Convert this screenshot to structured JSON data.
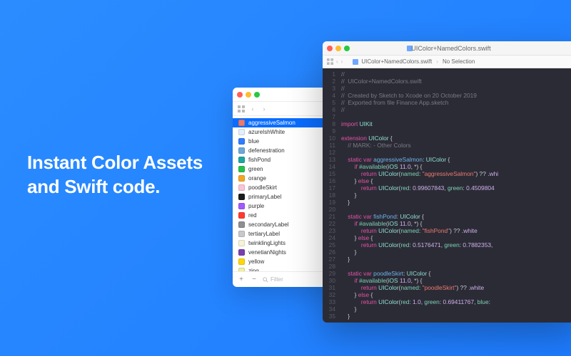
{
  "headline": "Instant Color Assets and Swift code.",
  "assetsWindow": {
    "filterPlaceholder": "Filter",
    "colors": [
      {
        "name": "aggressiveSalmon",
        "hex": "#e97a6f",
        "selected": true
      },
      {
        "name": "azureIshWhite",
        "hex": "#e2f0fb",
        "selected": false
      },
      {
        "name": "blue",
        "hex": "#2f7dff",
        "selected": false
      },
      {
        "name": "defenestration",
        "hex": "#6ea7d9",
        "selected": false
      },
      {
        "name": "fishPond",
        "hex": "#1ca7a0",
        "selected": false
      },
      {
        "name": "green",
        "hex": "#29c14e",
        "selected": false
      },
      {
        "name": "orange",
        "hex": "#f5a623",
        "selected": false
      },
      {
        "name": "poodleSkirt",
        "hex": "#f8c6d6",
        "selected": false
      },
      {
        "name": "primaryLabel",
        "hex": "#1c1c1e",
        "selected": false
      },
      {
        "name": "purple",
        "hex": "#a259ff",
        "selected": false
      },
      {
        "name": "red",
        "hex": "#ff3b30",
        "selected": false
      },
      {
        "name": "secondaryLabel",
        "hex": "#8e8e93",
        "selected": false
      },
      {
        "name": "tertiaryLabel",
        "hex": "#c7c7cc",
        "selected": false
      },
      {
        "name": "twinklingLights",
        "hex": "#f7f3d9",
        "selected": false
      },
      {
        "name": "venetianNights",
        "hex": "#7a3eb1",
        "selected": false
      },
      {
        "name": "yellow",
        "hex": "#ffd60a",
        "selected": false
      },
      {
        "name": "zing",
        "hex": "#f0f0a0",
        "selected": false
      }
    ]
  },
  "codeWindow": {
    "title": "UIColor+NamedColors.swift",
    "breadcrumb": {
      "file": "UIColor+NamedColors.swift",
      "selection": "No Selection"
    },
    "lines": [
      [
        {
          "t": "//",
          "c": "c-comment"
        }
      ],
      [
        {
          "t": "//  UIColor+NamedColors.swift",
          "c": "c-comment"
        }
      ],
      [
        {
          "t": "//",
          "c": "c-comment"
        }
      ],
      [
        {
          "t": "//  Created by Sketch to Xcode on 20 October 2019",
          "c": "c-comment"
        }
      ],
      [
        {
          "t": "//  Exported from file Finance App.sketch",
          "c": "c-comment"
        }
      ],
      [
        {
          "t": "//",
          "c": "c-comment"
        }
      ],
      [
        {
          "t": " ",
          "c": "c-default"
        }
      ],
      [
        {
          "t": "import ",
          "c": "c-keyword"
        },
        {
          "t": "UIKit",
          "c": "c-type"
        }
      ],
      [
        {
          "t": " ",
          "c": "c-default"
        }
      ],
      [
        {
          "t": "extension ",
          "c": "c-keyword"
        },
        {
          "t": "UIColor ",
          "c": "c-type"
        },
        {
          "t": "{",
          "c": "c-default"
        }
      ],
      [
        {
          "t": "    // MARK: - Other Colors",
          "c": "c-comment"
        }
      ],
      [
        {
          "t": " ",
          "c": "c-default"
        }
      ],
      [
        {
          "t": "    static var ",
          "c": "c-keyword"
        },
        {
          "t": "aggressiveSalmon",
          "c": "c-varname"
        },
        {
          "t": ": ",
          "c": "c-default"
        },
        {
          "t": "UIColor ",
          "c": "c-type"
        },
        {
          "t": "{",
          "c": "c-default"
        }
      ],
      [
        {
          "t": "        if ",
          "c": "c-keyword"
        },
        {
          "t": "#available",
          "c": "c-func"
        },
        {
          "t": "(",
          "c": "c-default"
        },
        {
          "t": "iOS ",
          "c": "c-type"
        },
        {
          "t": "11.0",
          "c": "c-number"
        },
        {
          "t": ", *) {",
          "c": "c-default"
        }
      ],
      [
        {
          "t": "            return ",
          "c": "c-keyword"
        },
        {
          "t": "UIColor",
          "c": "c-type"
        },
        {
          "t": "(",
          "c": "c-default"
        },
        {
          "t": "named",
          "c": "c-func"
        },
        {
          "t": ": ",
          "c": "c-default"
        },
        {
          "t": "\"aggressiveSalmon\"",
          "c": "c-string"
        },
        {
          "t": ") ?? .",
          "c": "c-default"
        },
        {
          "t": "whi",
          "c": "c-enum"
        }
      ],
      [
        {
          "t": "        } ",
          "c": "c-default"
        },
        {
          "t": "else ",
          "c": "c-keyword"
        },
        {
          "t": "{",
          "c": "c-default"
        }
      ],
      [
        {
          "t": "            return ",
          "c": "c-keyword"
        },
        {
          "t": "UIColor",
          "c": "c-type"
        },
        {
          "t": "(",
          "c": "c-default"
        },
        {
          "t": "red",
          "c": "c-func"
        },
        {
          "t": ": ",
          "c": "c-default"
        },
        {
          "t": "0.99607843",
          "c": "c-number"
        },
        {
          "t": ", ",
          "c": "c-default"
        },
        {
          "t": "green",
          "c": "c-func"
        },
        {
          "t": ": ",
          "c": "c-default"
        },
        {
          "t": "0.4509804",
          "c": "c-number"
        }
      ],
      [
        {
          "t": "        }",
          "c": "c-default"
        }
      ],
      [
        {
          "t": "    }",
          "c": "c-default"
        }
      ],
      [
        {
          "t": " ",
          "c": "c-default"
        }
      ],
      [
        {
          "t": "    static var ",
          "c": "c-keyword"
        },
        {
          "t": "fishPond",
          "c": "c-varname"
        },
        {
          "t": ": ",
          "c": "c-default"
        },
        {
          "t": "UIColor ",
          "c": "c-type"
        },
        {
          "t": "{",
          "c": "c-default"
        }
      ],
      [
        {
          "t": "        if ",
          "c": "c-keyword"
        },
        {
          "t": "#available",
          "c": "c-func"
        },
        {
          "t": "(",
          "c": "c-default"
        },
        {
          "t": "iOS ",
          "c": "c-type"
        },
        {
          "t": "11.0",
          "c": "c-number"
        },
        {
          "t": ", *) {",
          "c": "c-default"
        }
      ],
      [
        {
          "t": "            return ",
          "c": "c-keyword"
        },
        {
          "t": "UIColor",
          "c": "c-type"
        },
        {
          "t": "(",
          "c": "c-default"
        },
        {
          "t": "named",
          "c": "c-func"
        },
        {
          "t": ": ",
          "c": "c-default"
        },
        {
          "t": "\"fishPond\"",
          "c": "c-string"
        },
        {
          "t": ") ?? .",
          "c": "c-default"
        },
        {
          "t": "white",
          "c": "c-enum"
        }
      ],
      [
        {
          "t": "        } ",
          "c": "c-default"
        },
        {
          "t": "else ",
          "c": "c-keyword"
        },
        {
          "t": "{",
          "c": "c-default"
        }
      ],
      [
        {
          "t": "            return ",
          "c": "c-keyword"
        },
        {
          "t": "UIColor",
          "c": "c-type"
        },
        {
          "t": "(",
          "c": "c-default"
        },
        {
          "t": "red",
          "c": "c-func"
        },
        {
          "t": ": ",
          "c": "c-default"
        },
        {
          "t": "0.5176471",
          "c": "c-number"
        },
        {
          "t": ", ",
          "c": "c-default"
        },
        {
          "t": "green",
          "c": "c-func"
        },
        {
          "t": ": ",
          "c": "c-default"
        },
        {
          "t": "0.7882353",
          "c": "c-number"
        },
        {
          "t": ",",
          "c": "c-default"
        }
      ],
      [
        {
          "t": "        }",
          "c": "c-default"
        }
      ],
      [
        {
          "t": "    }",
          "c": "c-default"
        }
      ],
      [
        {
          "t": " ",
          "c": "c-default"
        }
      ],
      [
        {
          "t": "    static var ",
          "c": "c-keyword"
        },
        {
          "t": "poodleSkirt",
          "c": "c-varname"
        },
        {
          "t": ": ",
          "c": "c-default"
        },
        {
          "t": "UIColor ",
          "c": "c-type"
        },
        {
          "t": "{",
          "c": "c-default"
        }
      ],
      [
        {
          "t": "        if ",
          "c": "c-keyword"
        },
        {
          "t": "#available",
          "c": "c-func"
        },
        {
          "t": "(",
          "c": "c-default"
        },
        {
          "t": "iOS ",
          "c": "c-type"
        },
        {
          "t": "11.0",
          "c": "c-number"
        },
        {
          "t": ", *) {",
          "c": "c-default"
        }
      ],
      [
        {
          "t": "            return ",
          "c": "c-keyword"
        },
        {
          "t": "UIColor",
          "c": "c-type"
        },
        {
          "t": "(",
          "c": "c-default"
        },
        {
          "t": "named",
          "c": "c-func"
        },
        {
          "t": ": ",
          "c": "c-default"
        },
        {
          "t": "\"poodleSkirt\"",
          "c": "c-string"
        },
        {
          "t": ") ?? .",
          "c": "c-default"
        },
        {
          "t": "white",
          "c": "c-enum"
        }
      ],
      [
        {
          "t": "        } ",
          "c": "c-default"
        },
        {
          "t": "else ",
          "c": "c-keyword"
        },
        {
          "t": "{",
          "c": "c-default"
        }
      ],
      [
        {
          "t": "            return ",
          "c": "c-keyword"
        },
        {
          "t": "UIColor",
          "c": "c-type"
        },
        {
          "t": "(",
          "c": "c-default"
        },
        {
          "t": "red",
          "c": "c-func"
        },
        {
          "t": ": ",
          "c": "c-default"
        },
        {
          "t": "1.0",
          "c": "c-number"
        },
        {
          "t": ", ",
          "c": "c-default"
        },
        {
          "t": "green",
          "c": "c-func"
        },
        {
          "t": ": ",
          "c": "c-default"
        },
        {
          "t": "0.69411767",
          "c": "c-number"
        },
        {
          "t": ", ",
          "c": "c-default"
        },
        {
          "t": "blue",
          "c": "c-func"
        },
        {
          "t": ":",
          "c": "c-default"
        }
      ],
      [
        {
          "t": "        }",
          "c": "c-default"
        }
      ],
      [
        {
          "t": "    }",
          "c": "c-default"
        }
      ]
    ]
  }
}
